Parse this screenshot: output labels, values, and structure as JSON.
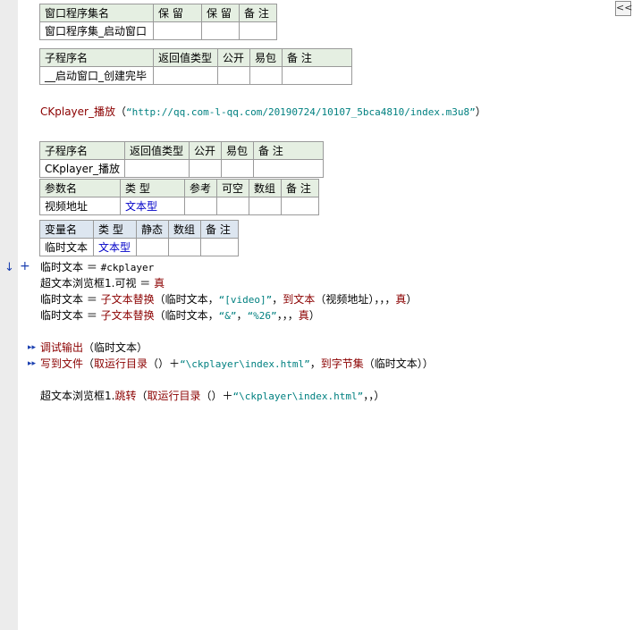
{
  "collapse_button": "<<",
  "window_set_table": {
    "headers": [
      "窗口程序集名",
      "保 留",
      "保 留",
      "备 注"
    ],
    "row": [
      "窗口程序集_启动窗口",
      "",
      "",
      ""
    ]
  },
  "sub1_table": {
    "headers": [
      "子程序名",
      "返回值类型",
      "公开",
      "易包",
      "备 注"
    ],
    "row": [
      "__启动窗口_创建完毕",
      "",
      "",
      "",
      ""
    ]
  },
  "call_line": {
    "func": "CKplayer_播放",
    "paren_open": "（",
    "arg": "“http://qq.com-l-qq.com/20190724/10107_5bca4810/index.m3u8”",
    "paren_close": "）"
  },
  "sub2_table": {
    "headers": [
      "子程序名",
      "返回值类型",
      "公开",
      "易包",
      "备 注"
    ],
    "row": [
      "CKplayer_播放",
      "",
      "",
      "",
      ""
    ]
  },
  "param_table": {
    "headers": [
      "参数名",
      "类 型",
      "参考",
      "可空",
      "数组",
      "备 注"
    ],
    "row": [
      "视频地址",
      "文本型",
      "",
      "",
      "",
      ""
    ]
  },
  "var_table": {
    "headers": [
      "变量名",
      "类 型",
      "静态",
      "数组",
      "备 注"
    ],
    "row": [
      "临时文本",
      "文本型",
      "",
      "",
      ""
    ]
  },
  "markers": {
    "arrow": "↓",
    "plus": "+",
    "expand": "▸▸"
  },
  "code": {
    "l1": {
      "a": "临时文本 ＝ ",
      "b": "#ckplayer"
    },
    "l2": {
      "a": "超文本浏览框1.可视 ＝ ",
      "b": "真"
    },
    "l3": {
      "a": "临时文本 ＝ ",
      "fn": "子文本替换",
      "p1": "（临时文本，",
      "s1": "“[video]”",
      "p2": "，",
      "fn2": "到文本",
      "p3": "（视频地址），，，",
      "t": "真",
      "p4": "）"
    },
    "l4": {
      "a": "临时文本 ＝ ",
      "fn": "子文本替换",
      "p1": "（临时文本，",
      "s1": "“&”",
      "p2": "，",
      "s2": "“%26”",
      "p3": "，，，",
      "t": "真",
      "p4": "）"
    },
    "l5": {
      "fn": "调试输出",
      "p1": "（临时文本）"
    },
    "l6": {
      "fn": "写到文件",
      "p1": "（",
      "fn2": "取运行目录",
      "p2": "（）＋",
      "s1": "“\\ckplayer\\index.html”",
      "p3": "，",
      "fn3": "到字节集",
      "p4": "（临时文本））"
    },
    "l7": {
      "a": "超文本浏览框1.",
      "fn": "跳转",
      "p1": "（",
      "fn2": "取运行目录",
      "p2": "（）＋",
      "s1": "“\\ckplayer\\index.html”",
      "p3": "，，）"
    }
  }
}
